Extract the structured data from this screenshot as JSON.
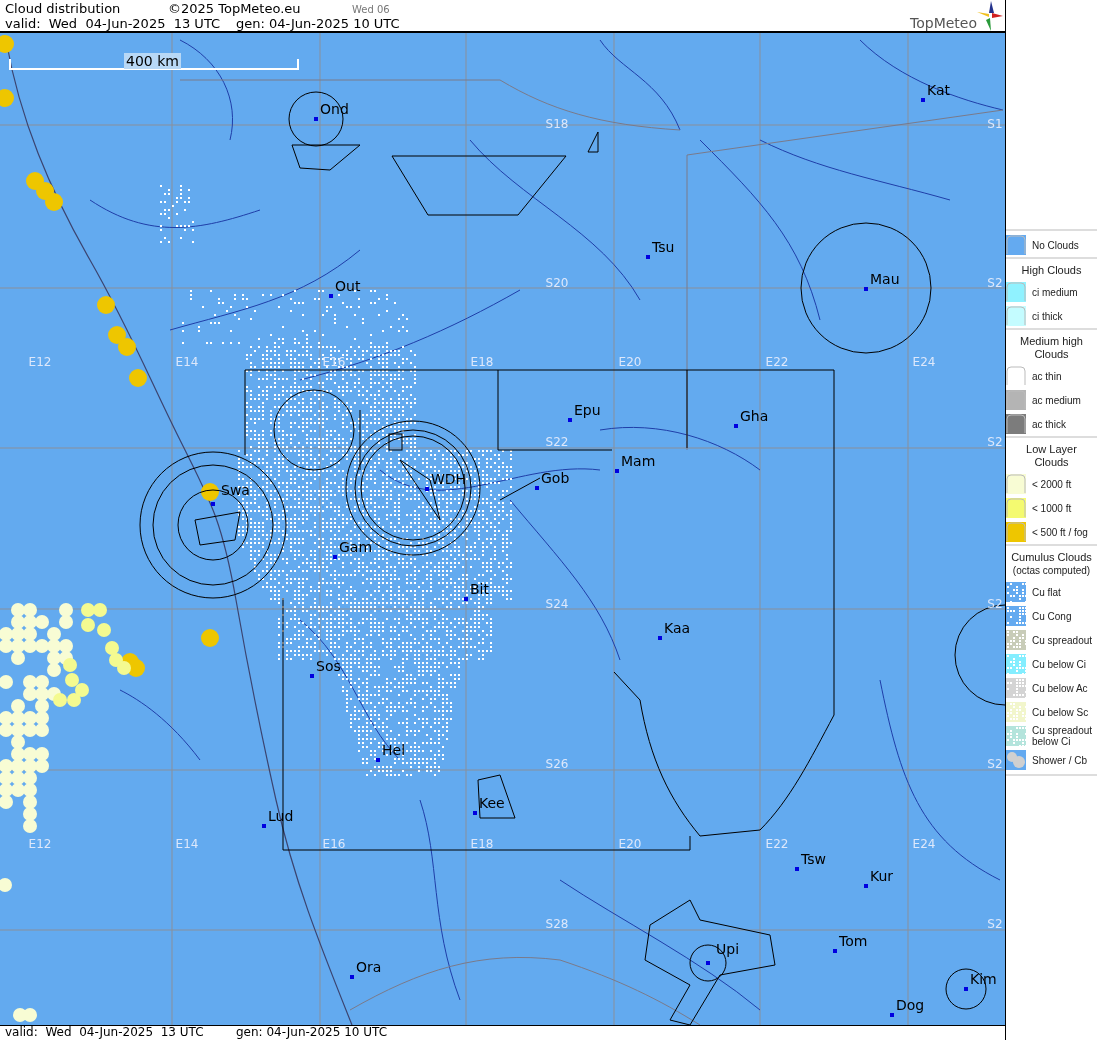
{
  "header": {
    "title": "Cloud distribution",
    "copyright": "©2025 TopMeteo.eu",
    "day": "Wed 06",
    "valid": "valid:  Wed  04-Jun-2025  13 UTC",
    "generated": "gen: 04-Jun-2025 10 UTC",
    "logo": "TopMeteo"
  },
  "map": {
    "scale": "400 km",
    "grid_labels": [
      "E12",
      "E14",
      "E16",
      "E18",
      "E20",
      "E22",
      "E24",
      "E12",
      "E14",
      "E16",
      "E18",
      "E20",
      "E22",
      "E24",
      "S18",
      "S20",
      "S22",
      "S24",
      "S26",
      "S28",
      "S1",
      "S2",
      "S2",
      "S2",
      "S2",
      "S2"
    ],
    "cities": [
      "Ond",
      "Kat",
      "Tsu",
      "Out",
      "Mau",
      "Epu",
      "Gha",
      "Mam",
      "WDH",
      "Gob",
      "Swa",
      "Gam",
      "Bit",
      "Kaa",
      "Sos",
      "Hel",
      "Lud",
      "Kee",
      "Tsw",
      "Kur",
      "Tom",
      "Upi",
      "Ora",
      "Kim",
      "Dog"
    ]
  },
  "legend": [
    {
      "kind": "fill",
      "label": "No Clouds",
      "color": "#64aaf0"
    },
    {
      "kind": "heading",
      "label": "High Clouds"
    },
    {
      "kind": "fill",
      "label": "ci medium",
      "color": "#90f2ff"
    },
    {
      "kind": "fill",
      "label": "ci thick",
      "color": "#c4fcff"
    },
    {
      "kind": "heading",
      "label": "Medium high Clouds"
    },
    {
      "kind": "fill",
      "label": "ac thin",
      "color": "#ffffff"
    },
    {
      "kind": "fill",
      "label": "ac medium",
      "color": "#b4b4b4"
    },
    {
      "kind": "fill",
      "label": "ac thick",
      "color": "#7c7c7c"
    },
    {
      "kind": "heading",
      "label": "Low Layer Clouds"
    },
    {
      "kind": "fill",
      "label": "< 2000 ft",
      "color": "#f8fcd4"
    },
    {
      "kind": "fill",
      "label": "< 1000 ft",
      "color": "#f4fa70"
    },
    {
      "kind": "fill",
      "label": "< 500 ft / fog",
      "color": "#eec600"
    },
    {
      "kind": "heading",
      "label": "Cumulus Clouds",
      "note": "(octas computed)"
    },
    {
      "kind": "cu",
      "label": "Cu flat",
      "color": "#64aaf0"
    },
    {
      "kind": "cu",
      "label": "Cu Cong",
      "color": "#64aaf0"
    },
    {
      "kind": "cu",
      "label": "Cu spreadout",
      "color": "#c8ccb8"
    },
    {
      "kind": "cu",
      "label": "Cu below Ci",
      "color": "#84eeff"
    },
    {
      "kind": "cu",
      "label": "Cu below Ac",
      "color": "#d4d4d4"
    },
    {
      "kind": "cu",
      "label": "Cu below Sc",
      "color": "#f2f6cc"
    },
    {
      "kind": "cu",
      "label": "Cu spreadout below Ci",
      "color": "#b4e4dc"
    },
    {
      "kind": "cb",
      "label": "Shower / Cb",
      "color": "#64aaf0"
    }
  ],
  "footer": {
    "valid": "valid:  Wed  04-Jun-2025  13 UTC",
    "generated": "gen: 04-Jun-2025 10 UTC"
  }
}
